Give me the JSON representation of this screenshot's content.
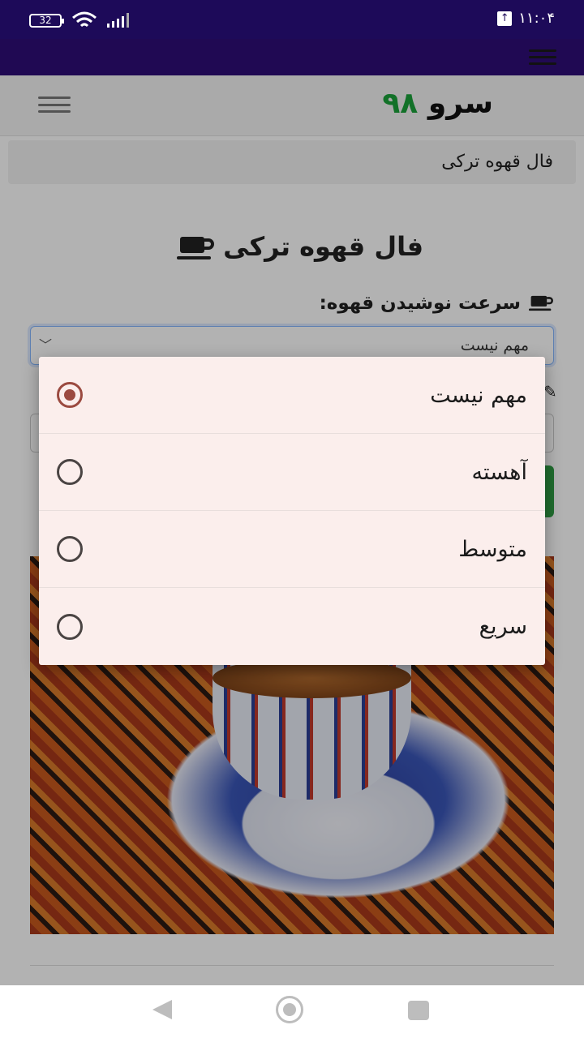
{
  "status_bar": {
    "battery": "32",
    "time": "۱۱:۰۴",
    "icons": [
      "wifi-icon",
      "signal-icon",
      "upload-icon"
    ]
  },
  "header": {
    "logo_text": "سرو",
    "logo_number": "۹۸"
  },
  "breadcrumb": {
    "current": "فال قهوه ترکی"
  },
  "main": {
    "title": "فال قهوه ترکی",
    "field_label": "سرعت نوشیدن قهوه:",
    "select_value": "مهم نیست"
  },
  "dialog": {
    "options": [
      {
        "label": "مهم نیست",
        "selected": true
      },
      {
        "label": "آهسته",
        "selected": false
      },
      {
        "label": "متوسط",
        "selected": false
      },
      {
        "label": "سریع",
        "selected": false
      }
    ]
  },
  "colors": {
    "status_bar": "#1d0a59",
    "purple_bar": "#2e0d77",
    "logo_number": "#1aa23a",
    "radio_selected": "#9b4a40",
    "dialog_bg": "#fbeeec"
  }
}
